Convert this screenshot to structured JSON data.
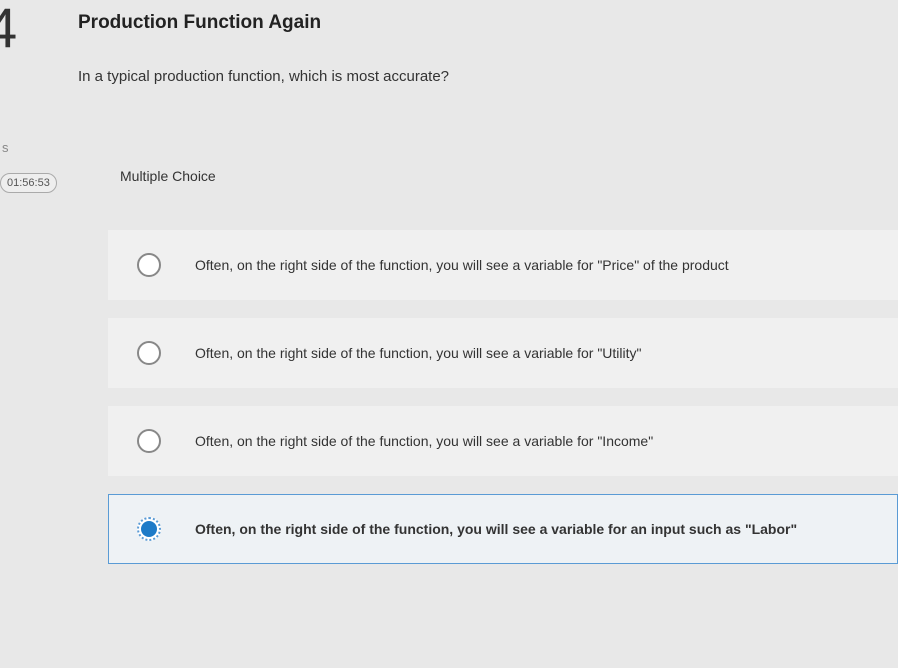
{
  "question": {
    "number": "4",
    "title": "Production Function Again",
    "prompt": "In a typical production function, which is most accurate?",
    "type_label": "Multiple Choice"
  },
  "sidebar": {
    "partial_text": "s",
    "timer": "01:56:53"
  },
  "options": [
    {
      "text": "Often, on the right side of the function, you will see a variable for \"Price\" of the product",
      "selected": false
    },
    {
      "text": "Often, on the right side of the function, you will see a variable for \"Utility\"",
      "selected": false
    },
    {
      "text": "Often, on the right side of the function, you will see a variable for \"Income\"",
      "selected": false
    },
    {
      "text": "Often, on the right side of the function, you will see a variable for an input such as \"Labor\"",
      "selected": true
    }
  ]
}
